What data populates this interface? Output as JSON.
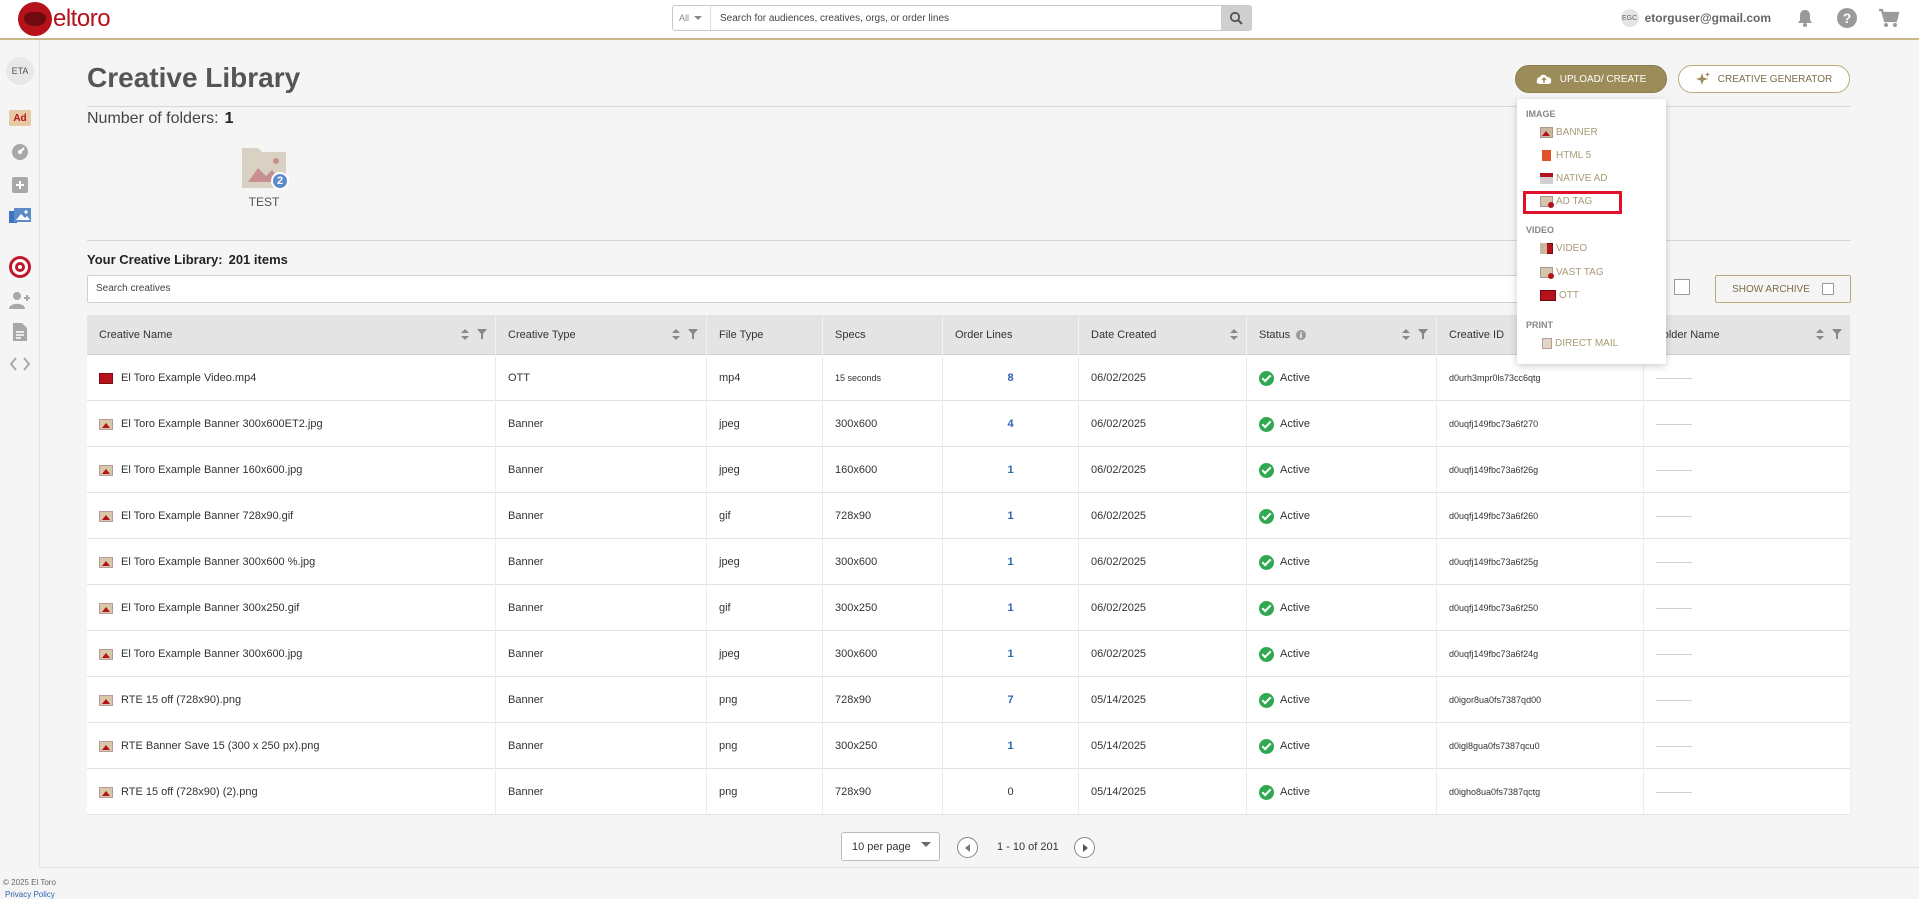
{
  "brand": {
    "name": "eltoro",
    "color": "#b5121b",
    "accent": "#9c8c5a"
  },
  "topbar": {
    "search_scope": "All",
    "search_placeholder": "Search for audiences, creatives, orgs, or order lines",
    "user_initials": "EGC",
    "user_email": "etorguser@gmail.com",
    "icons": [
      "bell-icon",
      "help-icon",
      "cart-icon"
    ]
  },
  "rail": {
    "org_badge": "ETA",
    "ad_badge": "Ad",
    "icons": [
      "dashboard-icon",
      "add-icon",
      "creative-library-icon",
      "target-icon",
      "add-user-icon",
      "document-icon",
      "code-icon"
    ]
  },
  "page": {
    "title": "Creative Library",
    "folders_label": "Number of folders:",
    "folders_count": "1",
    "folder": {
      "name": "TEST",
      "count": "2"
    },
    "library_label": "Your Creative Library:",
    "library_count": "201 items",
    "search_placeholder": "Search creatives",
    "show_archive": "SHOW ARCHIVE"
  },
  "buttons": {
    "upload_create": "UPLOAD/ CREATE",
    "creative_generator": "CREATIVE GENERATOR"
  },
  "dropdown": {
    "sections": [
      {
        "title": "IMAGE",
        "items": [
          "BANNER",
          "HTML 5",
          "NATIVE AD",
          "AD TAG"
        ]
      },
      {
        "title": "VIDEO",
        "items": [
          "VIDEO",
          "VAST TAG",
          "OTT"
        ]
      },
      {
        "title": "PRINT",
        "items": [
          "DIRECT MAIL"
        ]
      }
    ],
    "highlighted": "AD TAG"
  },
  "table": {
    "columns": [
      "Creative Name",
      "Creative Type",
      "File Type",
      "Specs",
      "Order Lines",
      "Date Created",
      "Status",
      "Creative ID",
      "Folder Name"
    ],
    "rows": [
      {
        "name": "El Toro Example Video.mp4",
        "type": "OTT",
        "file": "mp4",
        "specs": "15 seconds",
        "lines": "8",
        "date": "06/02/2025",
        "status": "Active",
        "id": "d0urh3mpr0ls73cc6qtg",
        "folder": "",
        "thumb": "video"
      },
      {
        "name": "El Toro Example Banner 300x600ET2.jpg",
        "type": "Banner",
        "file": "jpeg",
        "specs": "300x600",
        "lines": "4",
        "date": "06/02/2025",
        "status": "Active",
        "id": "d0uqfj149fbc73a6f270",
        "folder": "",
        "thumb": "image"
      },
      {
        "name": "El Toro Example Banner 160x600.jpg",
        "type": "Banner",
        "file": "jpeg",
        "specs": "160x600",
        "lines": "1",
        "date": "06/02/2025",
        "status": "Active",
        "id": "d0uqfj149fbc73a6f26g",
        "folder": "",
        "thumb": "image"
      },
      {
        "name": "El Toro Example Banner 728x90.gif",
        "type": "Banner",
        "file": "gif",
        "specs": "728x90",
        "lines": "1",
        "date": "06/02/2025",
        "status": "Active",
        "id": "d0uqfj149fbc73a6f260",
        "folder": "",
        "thumb": "image"
      },
      {
        "name": "El Toro Example Banner 300x600 %.jpg",
        "type": "Banner",
        "file": "jpeg",
        "specs": "300x600",
        "lines": "1",
        "date": "06/02/2025",
        "status": "Active",
        "id": "d0uqfj149fbc73a6f25g",
        "folder": "",
        "thumb": "image"
      },
      {
        "name": "El Toro Example Banner 300x250.gif",
        "type": "Banner",
        "file": "gif",
        "specs": "300x250",
        "lines": "1",
        "date": "06/02/2025",
        "status": "Active",
        "id": "d0uqfj149fbc73a6f250",
        "folder": "",
        "thumb": "image"
      },
      {
        "name": "El Toro Example Banner 300x600.jpg",
        "type": "Banner",
        "file": "jpeg",
        "specs": "300x600",
        "lines": "1",
        "date": "06/02/2025",
        "status": "Active",
        "id": "d0uqfj149fbc73a6f24g",
        "folder": "",
        "thumb": "image"
      },
      {
        "name": "RTE 15 off (728x90).png",
        "type": "Banner",
        "file": "png",
        "specs": "728x90",
        "lines": "7",
        "date": "05/14/2025",
        "status": "Active",
        "id": "d0igor8ua0fs7387qd00",
        "folder": "",
        "thumb": "image"
      },
      {
        "name": "RTE Banner Save 15 (300 x 250 px).png",
        "type": "Banner",
        "file": "png",
        "specs": "300x250",
        "lines": "1",
        "date": "05/14/2025",
        "status": "Active",
        "id": "d0igl8gua0fs7387qcu0",
        "folder": "",
        "thumb": "image"
      },
      {
        "name": "RTE 15 off (728x90) (2).png",
        "type": "Banner",
        "file": "png",
        "specs": "728x90",
        "lines": "0",
        "date": "05/14/2025",
        "status": "Active",
        "id": "d0igho8ua0fs7387qctg",
        "folder": "",
        "thumb": "image"
      }
    ]
  },
  "pagination": {
    "per_page": "10 per page",
    "range": "1 - 10 of 201"
  },
  "footer": {
    "copyright": "© 2025 El Toro",
    "privacy": "Privacy Policy"
  }
}
